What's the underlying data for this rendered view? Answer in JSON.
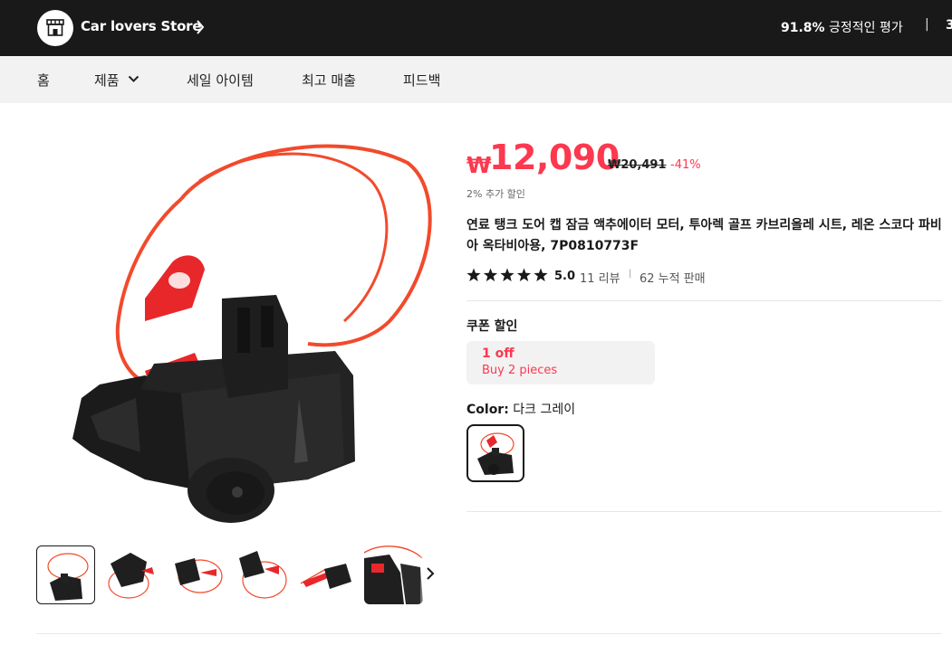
{
  "store": {
    "name": "Car lovers Store",
    "rating_percent": "91.8%",
    "rating_text": "긍정적인 평가",
    "separator": "|",
    "followers_partial": "3"
  },
  "nav": {
    "items": [
      {
        "label": "홈"
      },
      {
        "label": "제품"
      },
      {
        "label": "세일 아이템"
      },
      {
        "label": "최고 매출"
      },
      {
        "label": "피드백"
      }
    ]
  },
  "product": {
    "currency_symbol": "₩",
    "price": "12,090",
    "original_price": "₩20,491",
    "discount": "-41%",
    "extra_discount": "2% 추가 할인",
    "title": "연료 탱크 도어 캡 잠금 액추에이터 모터, 투아렉 골프 카브리올레 시트, 레온 스코다 파비아 옥타비아용, 7P0810773F",
    "rating": 5,
    "rating_text": "5.0",
    "reviews": "11 리뷰",
    "review_sep": "|",
    "sold": "62 누적 판매",
    "coupon_label": "쿠폰 할인",
    "coupon_title": "1 off",
    "coupon_sub": "Buy 2 pieces",
    "color_label": "Color:",
    "color_value": "다크 그레이",
    "thumbnail_count": 6
  },
  "colors": {
    "header_bg": "#191919",
    "nav_bg": "#f2f2f2",
    "accent": "#fd384f",
    "product_black": "#1c1c1c",
    "product_red": "#f24a2c"
  },
  "icons": {
    "store_logo": "storefront-icon",
    "store_chevron": "chevron-right-icon",
    "nav_dropdown": "chevron-down-icon",
    "rating": "star-icon",
    "thumbs_next": "chevron-right-icon"
  }
}
